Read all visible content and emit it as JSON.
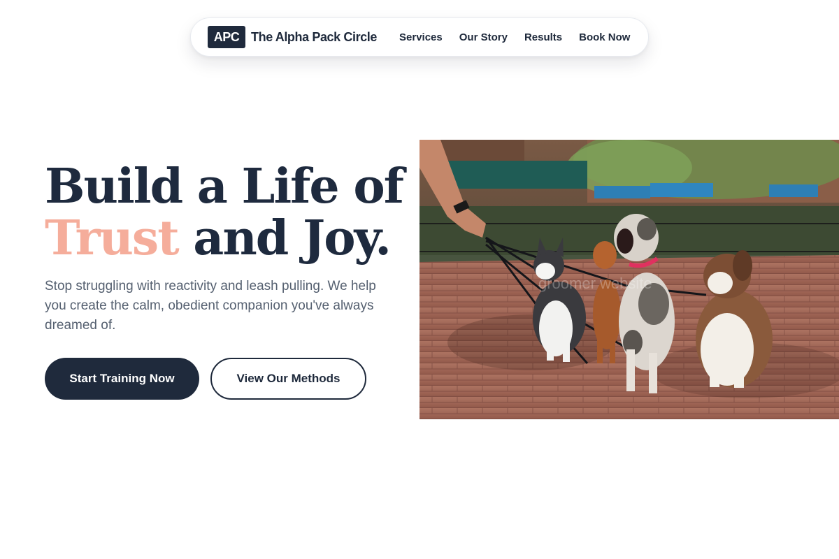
{
  "nav": {
    "logo_text": "APC",
    "brand_name": "The Alpha Pack Circle",
    "links": [
      {
        "label": "Services"
      },
      {
        "label": "Our Story"
      },
      {
        "label": "Results"
      },
      {
        "label": "Book Now"
      }
    ]
  },
  "hero": {
    "title_line1": "Build a Life of",
    "title_accent": "Trust",
    "title_line2_rest": " and Joy.",
    "subtitle": "Stop struggling with reactivity and leash pulling. We help you create the calm, obedient companion you've always dreamed of.",
    "primary_button": "Start Training Now",
    "secondary_button": "View Our Methods"
  },
  "colors": {
    "navy": "#1f2a3c",
    "accent_peach": "#f5ad9b",
    "body_text": "#556070"
  }
}
